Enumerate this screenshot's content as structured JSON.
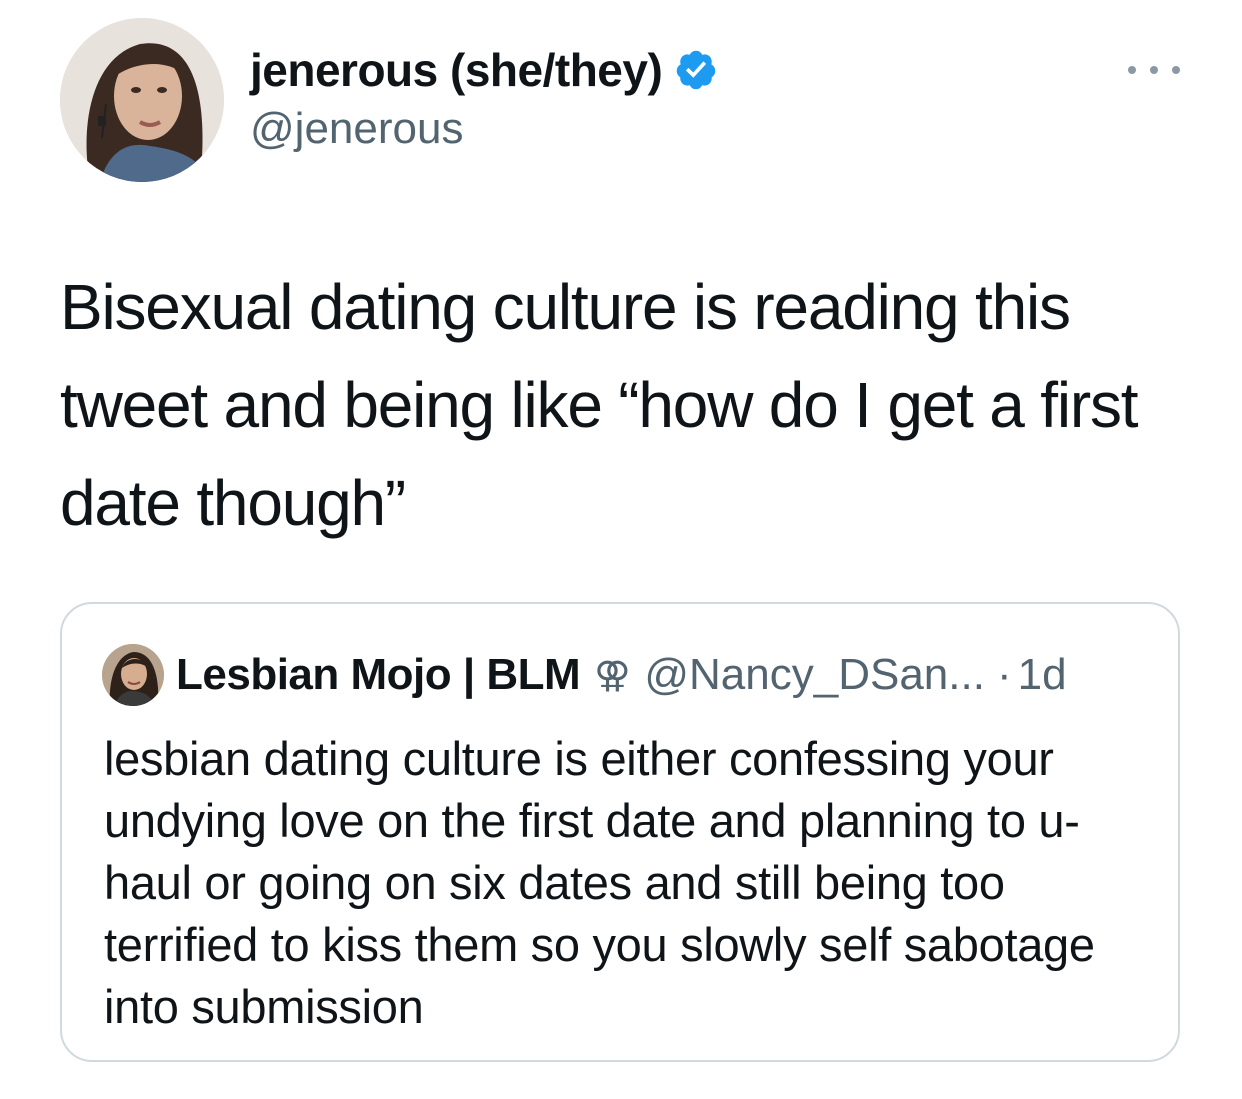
{
  "author": {
    "display_name": "jenerous (she/they)",
    "handle": "@jenerous",
    "verified": true,
    "verified_color": "#1d9bf0"
  },
  "tweet": {
    "text": "Bisexual dating culture is reading this tweet and being like “how do I get a first date though”"
  },
  "quoted_tweet": {
    "display_name": "Lesbian Mojo | BLM",
    "emoji": "⚢",
    "handle": "@Nancy_DSan...",
    "separator": "·",
    "time": "1d",
    "text": "lesbian dating culture is either confessing your undying love on the first date and planning to u-haul or going on six dates and still being too terrified to kiss them so you slowly self sabotage into submission"
  },
  "icons": {
    "more": "more-options-icon",
    "verified": "verified-badge-icon"
  },
  "colors": {
    "text": "#0f1419",
    "secondary": "#536471",
    "border": "#cfd9de",
    "accent": "#1d9bf0"
  }
}
